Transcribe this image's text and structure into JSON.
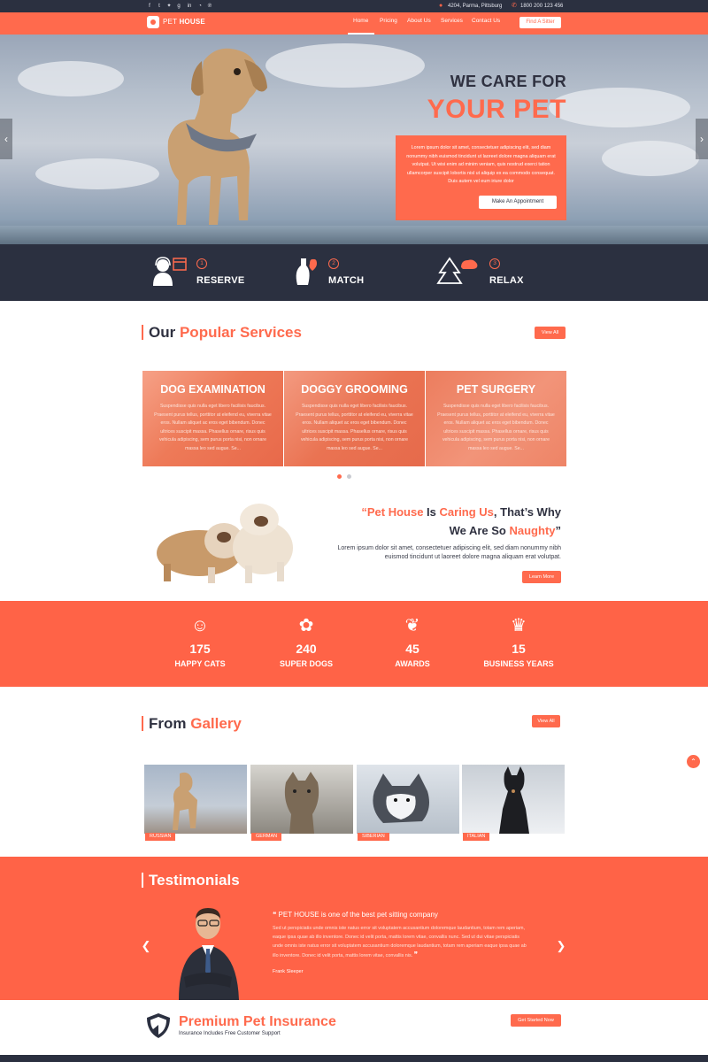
{
  "topbar": {
    "social_icons": [
      "facebook-icon",
      "tumblr-icon",
      "twitter-icon",
      "google-plus-icon",
      "linkedin-icon",
      "rss-icon",
      "pinterest-icon"
    ],
    "address": "4204, Parma,  Pittsburg",
    "phone": "1800 200 123 456"
  },
  "nav": {
    "brand_light": "PET",
    "brand_bold": "HOUSE",
    "links": [
      "Home",
      "Pricing",
      "About Us",
      "Services",
      "Contact Us"
    ],
    "active": "Home",
    "cta": "Find A Sitter"
  },
  "hero": {
    "line1": "WE CARE FOR",
    "line2": "YOUR PET",
    "text": "Lorem ipsum dolor sit amet, consectetuer adipiscing elit, sed diam nonummy nibh euismod tincidunt ut laoreet dolore magna aliquam erat volutpat. Ut wisi enim ad minim veniam, quis nostrud exerci tation ullamcorper suscipit lobortis nisl ut aliquip ex ea commodo consequat. Duis autem vel eum iriure dolor",
    "button": "Make An Appointment"
  },
  "steps": [
    {
      "num": "1",
      "label": "RESERVE"
    },
    {
      "num": "2",
      "label": "MATCH"
    },
    {
      "num": "3",
      "label": "RELAX"
    }
  ],
  "services": {
    "title_a": "Our",
    "title_b": "Popular Services",
    "view_all": "View All",
    "items": [
      {
        "title": "DOG EXAMINATION",
        "text": "Suspendisse quis nulla eget libero facilisis faucibus. Praesent purus tellus, porttitor at eleifend eu, viverra vitae eros. Nullam aliquet ac eros eget bibendum. Donec ultrices suscipit massa. Phasellus ornare, risus quis vehicula adipiscing, sem purus porta nisi, non ornare massa leo sed augue. Se..."
      },
      {
        "title": "DOGGY GROOMING",
        "text": "Suspendisse quis nulla eget libero facilisis faucibus. Praesent purus tellus, porttitor at eleifend eu, viverra vitae eros. Nullam aliquet ac eros eget bibendum. Donec ultrices suscipit massa. Phasellus ornare, risus quis vehicula adipiscing, sem purus porta nisi, non ornare massa leo sed augue. Se..."
      },
      {
        "title": "PET SURGERY",
        "text": "Suspendisse quis nulla eget libero facilisis faucibus. Praesent purus tellus, porttitor at eleifend eu, viverra vitae eros. Nullam aliquet ac eros eget bibendum. Donec ultrices suscipit massa. Phasellus ornare, risus quis vehicula adipiscing, sem purus porta nisi, non ornare massa leo sed augue. Se..."
      }
    ]
  },
  "caring": {
    "q_open": "“",
    "pet_house": "Pet House",
    "is": " Is ",
    "caring_us": "Caring Us",
    "rest1": ", That’s Why",
    "we_are_so": "We Are So ",
    "naughty": "Naughty",
    "q_close": "”",
    "text": "Lorem ipsum dolor sit amet, consectetuer adipiscing elit, sed diam nonummy nibh euismod tincidunt ut laoreet dolore magna aliquam erat volutpat.",
    "button": "Learn More"
  },
  "stats": [
    {
      "icon": "cat-icon",
      "glyph": "☺",
      "number": "175",
      "label": "HAPPY CATS"
    },
    {
      "icon": "dog-icon",
      "glyph": "✿",
      "number": "240",
      "label": "SUPER DOGS"
    },
    {
      "icon": "laurel-icon",
      "glyph": "❦",
      "number": "45",
      "label": "AWARDS"
    },
    {
      "icon": "crown-icon",
      "glyph": "♛",
      "number": "15",
      "label": "BUSINESS YEARS"
    }
  ],
  "gallery": {
    "title_a": "From",
    "title_b": "Gallery",
    "view_all": "View All",
    "items": [
      "RUSSIAN",
      "GERMAN",
      "SIBERIAN",
      "ITALIAN"
    ]
  },
  "testimonials": {
    "title": "Testimonials",
    "quote_title": "PET HOUSE is one of the best pet sitting company",
    "text": "Sed ut perspiciatis unde omnis iste natus error sit voluptatem accusantium doloremque laudantium, totam rem aperiam, eaque ipsa quae ab illo inventore. Donec id velit porta, mattis lorem vitae, convallis nunc. Sed ut dui vitae perspiciatis unde omnis iste natus error sit voluptatem accusantium doloremque laudantium, totam rem aperiam eaque ipsa quae ab illo inventore. Donec id velit porta, mattis lorem vitae, convallis nis.",
    "author": "Frank Sleeper"
  },
  "insurance": {
    "title": "Premium Pet Insurance",
    "subtitle": "Insurance Includes Free Customer Support",
    "button": "Get Started Now"
  },
  "colors": {
    "accent": "#ff6a4d",
    "dark": "#2b3040",
    "white": "#ffffff"
  }
}
